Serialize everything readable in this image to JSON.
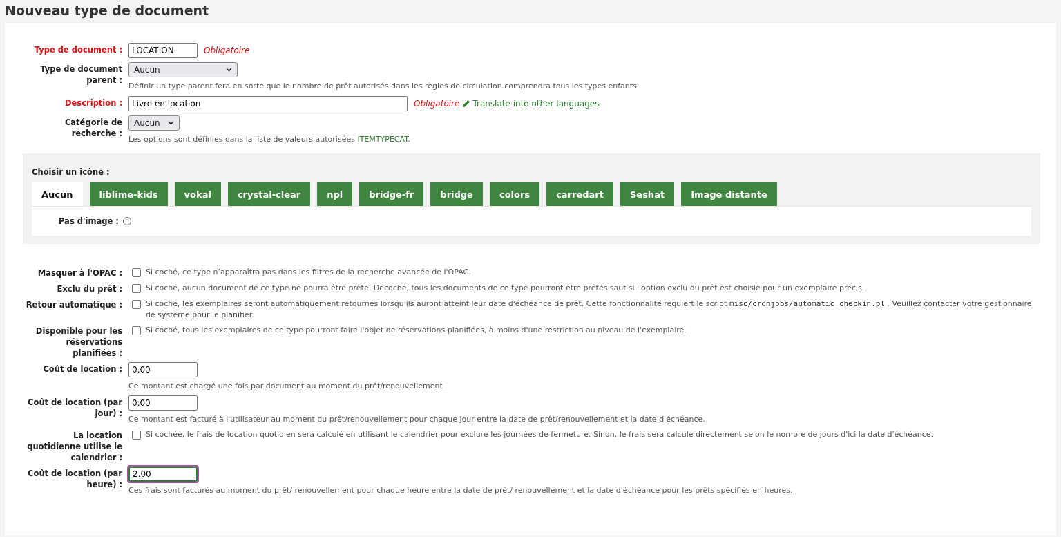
{
  "page_title": "Nouveau type de document",
  "fields_top": [
    {
      "kind": "input",
      "label": "Type de document :",
      "required": true,
      "value": "LOCATION",
      "required_note": "Obligatoire"
    },
    {
      "kind": "select",
      "label": "Type de document parent :",
      "required": false,
      "value": "Aucun",
      "wide": true,
      "hint": [
        {
          "kind": "plain",
          "text": "Définir un type parent fera en sorte que le nombre de prêt autorisés dans les règles de circulation comprendra tous les types enfants."
        }
      ]
    },
    {
      "kind": "input",
      "label": "Description :",
      "required": true,
      "value": "Livre en location",
      "wide": true,
      "required_note": "Obligatoire",
      "link": "Translate into other languages"
    },
    {
      "kind": "select",
      "label": "Catégorie de recherche :",
      "required": false,
      "value": "Aucun",
      "wide": false,
      "hint": [
        {
          "kind": "plain",
          "text": "Les options sont définies dans la liste de valeurs autorisées "
        },
        {
          "kind": "link",
          "text": "ITEMTYPECAT"
        },
        {
          "kind": "plain",
          "text": "."
        }
      ]
    }
  ],
  "icon_chooser": {
    "label": "Choisir un icône :",
    "tabs": [
      {
        "label": "Aucun",
        "selected": true
      },
      {
        "label": "liblime-kids",
        "selected": false
      },
      {
        "label": "vokal",
        "selected": false
      },
      {
        "label": "crystal-clear",
        "selected": false
      },
      {
        "label": "npl",
        "selected": false
      },
      {
        "label": "bridge-fr",
        "selected": false
      },
      {
        "label": "bridge",
        "selected": false
      },
      {
        "label": "colors",
        "selected": false
      },
      {
        "label": "carredart",
        "selected": false
      },
      {
        "label": "Seshat",
        "selected": false
      },
      {
        "label": "Image distante",
        "selected": false
      }
    ],
    "no_image": {
      "label": "Pas d'image :",
      "checked": false
    }
  },
  "fields_bottom": [
    {
      "kind": "checkbox",
      "label": "Masquer à l'OPAC :",
      "checked": false,
      "hint": [
        {
          "kind": "plain",
          "text": "Si coché, ce type n’apparaîtra pas dans les filtres de la recherche avancée de l'OPAC."
        }
      ]
    },
    {
      "kind": "checkbox",
      "label": "Exclu du prêt :",
      "checked": false,
      "hint": [
        {
          "kind": "plain",
          "text": "Si coché, aucun document de ce type ne pourra être prêté. Décoché, tous les documents de ce type pourront être prêtés sauf si l'option exclu du prêt est choisie pour un exemplaire précis."
        }
      ]
    },
    {
      "kind": "checkbox",
      "label": "Retour automatique :",
      "checked": false,
      "hint": [
        {
          "kind": "plain",
          "text": "Si coché, les exemplaires seront automatiquement retournés lorsqu'ils auront atteint leur date d'échéance de prêt. Cette fonctionnalité requiert le script "
        },
        {
          "kind": "code",
          "text": "misc/cronjobs/automatic_checkin.pl"
        },
        {
          "kind": "plain",
          "text": " . Veuillez contacter votre gestionnaire de système pour le planifier."
        }
      ]
    },
    {
      "kind": "checkbox",
      "label": "Disponible pour les réservations planifiées :",
      "checked": false,
      "hint": [
        {
          "kind": "plain",
          "text": "Si coché, tous les exemplaires de ce type pourront faire l'objet de réservations planifiées, à moins d'une restriction au niveau de l'exemplaire."
        }
      ]
    },
    {
      "kind": "input",
      "label": "Coût de location :",
      "required": false,
      "value": "0.00",
      "focused": false,
      "hint": [
        {
          "kind": "plain",
          "text": "Ce montant est chargé une fois par document au moment du prêt/renouvellement"
        }
      ]
    },
    {
      "kind": "input",
      "label": "Coût de location (par jour) :",
      "required": false,
      "value": "0.00",
      "focused": false,
      "hint": [
        {
          "kind": "plain",
          "text": "Ce montant est facturé à l'utilisateur au moment du prêt/renouvellement pour chaque jour entre la date de prêt/renouvellement et la date d'échéance."
        }
      ]
    },
    {
      "kind": "checkbox",
      "label": "La location quotidienne utilise le calendrier :",
      "checked": false,
      "hint": [
        {
          "kind": "plain",
          "text": "Si cochée, le frais de location quotidien sera calculé en utilisant le calendrier pour exclure les journées de fermeture. Sinon, le frais sera calculé directement selon le nombre de jours d'ici la date d'échéance."
        }
      ]
    },
    {
      "kind": "input",
      "label": "Coût de location (par heure) :",
      "required": false,
      "value": "2.00",
      "focused": true,
      "hint": [
        {
          "kind": "plain",
          "text": "Ces frais sont facturés au moment du prêt/ renouvellement pour chaque heure entre la date de prêt/ renouvellement et la date d'échéance pour les prêts spécifiés en heures."
        }
      ]
    }
  ]
}
